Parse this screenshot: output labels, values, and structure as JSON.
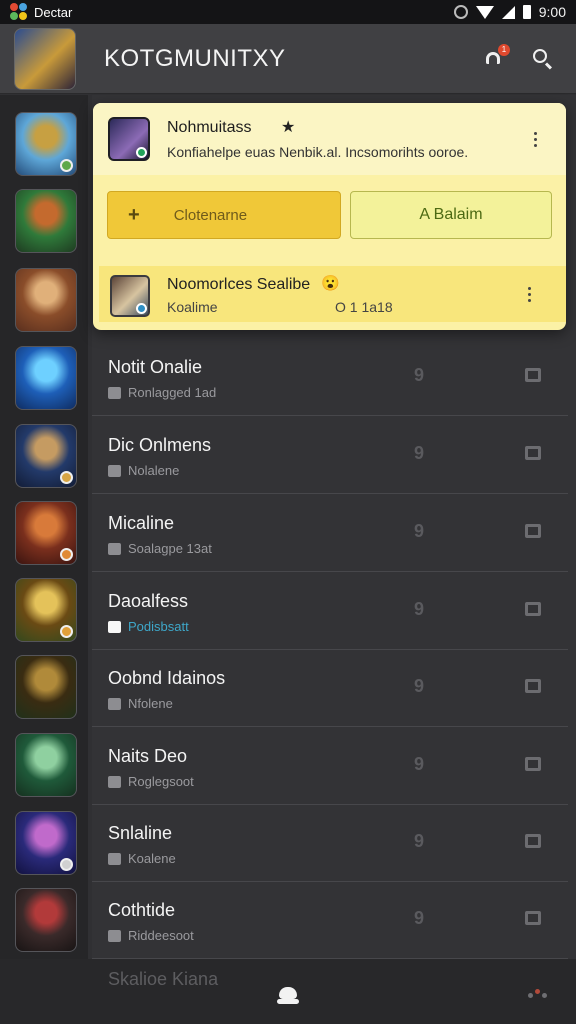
{
  "status_bar": {
    "left_text": "Dectar",
    "time": "9:00"
  },
  "header": {
    "title": "KOTGMUNITXY",
    "notification_badge": "1"
  },
  "sidebar": {
    "items": [
      {
        "name": "avatar-1",
        "colors": [
          "#5ea7d8",
          "#c7a042",
          "#244c7a"
        ],
        "status": "#5ea84a"
      },
      {
        "name": "avatar-2",
        "colors": [
          "#2f7a3a",
          "#c46a2e",
          "#1e3b21"
        ],
        "status": ""
      },
      {
        "name": "avatar-3",
        "colors": [
          "#8a4d2a",
          "#e0b07a",
          "#5a2f1e"
        ],
        "status": ""
      },
      {
        "name": "avatar-4",
        "colors": [
          "#1e5fb8",
          "#6ed0ff",
          "#0f2c61"
        ],
        "status": ""
      },
      {
        "name": "avatar-5",
        "colors": [
          "#233a6a",
          "#c59b62",
          "#121c36"
        ],
        "status": "#d7a545"
      },
      {
        "name": "avatar-6",
        "colors": [
          "#7a2f1d",
          "#d87a3a",
          "#3a1410"
        ],
        "status": "#e08a35"
      },
      {
        "name": "avatar-7",
        "colors": [
          "#6a4a14",
          "#e4c25a",
          "#33491d"
        ],
        "status": "#e0a03a"
      },
      {
        "name": "avatar-8",
        "colors": [
          "#3a2c12",
          "#b08a3a",
          "#20301a"
        ],
        "status": ""
      },
      {
        "name": "avatar-9",
        "colors": [
          "#1f5a3a",
          "#8fd0a0",
          "#15301f"
        ],
        "status": ""
      },
      {
        "name": "avatar-10",
        "colors": [
          "#2a2a7a",
          "#c06acb",
          "#121240"
        ],
        "status": "#d0d0d0"
      },
      {
        "name": "avatar-11",
        "colors": [
          "#3a2a2a",
          "#b23a3a",
          "#181414"
        ],
        "status": ""
      }
    ]
  },
  "card": {
    "title": "Nohmuitass",
    "star": "★",
    "description": "Konfiahelpe euas Nenbik.al. Incsomorihts ooroe.",
    "primary_plus": "+",
    "primary_label": "Clotenarne",
    "secondary_label": "A Balaim",
    "sub": {
      "title": "Noomorlces Sealibe",
      "emoji": "😮",
      "left": "Koalime",
      "right": "O 1 1a18"
    }
  },
  "list": {
    "rows": [
      {
        "title": "Notit Onalie",
        "sub": "Ronlagged 1ad",
        "count": "9",
        "active": false
      },
      {
        "title": "Dic Onlmens",
        "sub": "Nolalene",
        "count": "9",
        "active": false
      },
      {
        "title": "Micaline",
        "sub": "Soalagpe 13at",
        "count": "9",
        "active": false
      },
      {
        "title": "Daoalfess",
        "sub": "Podisbsatt",
        "count": "9",
        "active": true
      },
      {
        "title": "Oobnd Idainos",
        "sub": "Nfolene",
        "count": "9",
        "active": false
      },
      {
        "title": "Naits Deo",
        "sub": "Roglegsoot",
        "count": "9",
        "active": false
      },
      {
        "title": "Snlaline",
        "sub": "Koalene",
        "count": "9",
        "active": false
      },
      {
        "title": "Cothtide",
        "sub": "Riddeesoot",
        "count": "9",
        "active": false
      }
    ]
  },
  "bottom": {
    "faded_text": "Skalioe Kiana"
  }
}
